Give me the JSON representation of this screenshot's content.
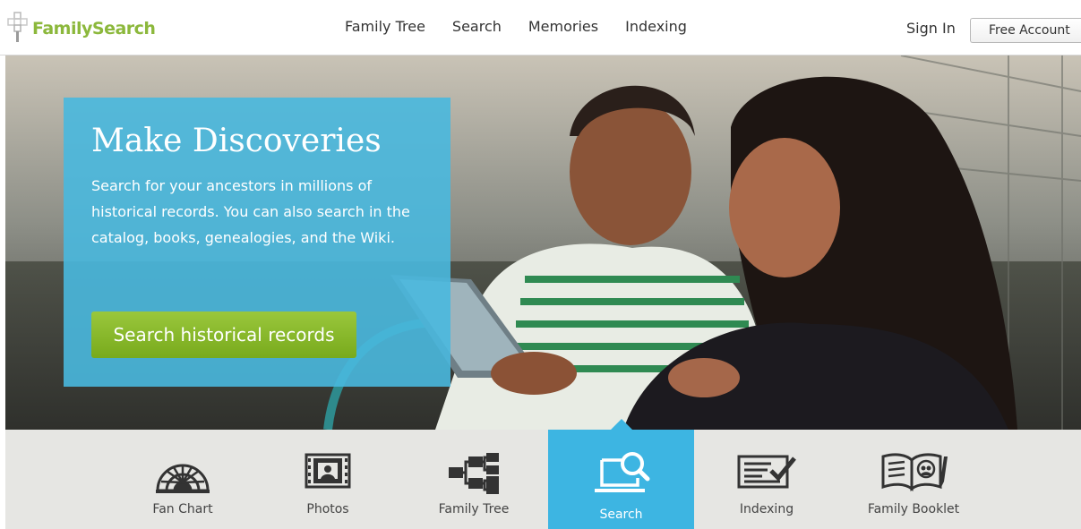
{
  "brand": {
    "name": "FamilySearch",
    "color": "#8cb83c"
  },
  "nav": {
    "items": [
      "Family Tree",
      "Search",
      "Memories",
      "Indexing"
    ]
  },
  "account": {
    "signin_label": "Sign In",
    "free_account_label": "Free Account"
  },
  "hero": {
    "title": "Make Discoveries",
    "description": "Search for your ancestors in millions of historical records. You can also search in the catalog, books, genealogies, and the Wiki.",
    "button_label": "Search historical records",
    "panel_color": "#49b8de",
    "button_color": "#8ab82e"
  },
  "tools": {
    "items": [
      {
        "label": "Fan Chart",
        "icon": "fan-chart-icon"
      },
      {
        "label": "Photos",
        "icon": "photos-icon"
      },
      {
        "label": "Family Tree",
        "icon": "family-tree-icon"
      },
      {
        "label": "Search",
        "icon": "search-laptop-icon",
        "active": true
      },
      {
        "label": "Indexing",
        "icon": "indexing-icon"
      },
      {
        "label": "Family Booklet",
        "icon": "family-booklet-icon"
      }
    ],
    "active_color": "#3db5e2"
  }
}
